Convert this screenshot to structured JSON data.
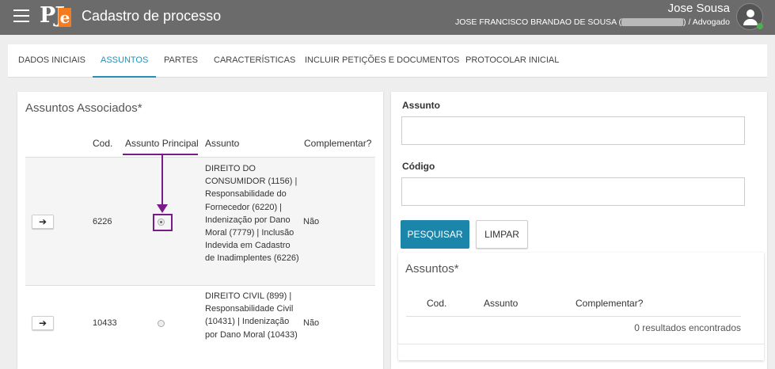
{
  "topbar": {
    "menu_icon": "hamburger-icon",
    "logo_text": "PJ",
    "logo_e": "e",
    "title": "Cadastro de processo",
    "user_name": "Jose Sousa",
    "user_full_prefix": "JOSE FRANCISCO BRANDAO DE SOUSA (",
    "user_full_suffix": ") / Advogado",
    "avatar_icon": "user-icon",
    "status_color": "#4caf50"
  },
  "tabs": [
    {
      "label": "DADOS INICIAIS"
    },
    {
      "label": "ASSUNTOS"
    },
    {
      "label": "PARTES"
    },
    {
      "label": "CARACTERÍSTICAS"
    },
    {
      "label": "INCLUIR PETIÇÕES E DOCUMENTOS"
    },
    {
      "label": "PROTOCOLAR INICIAL"
    }
  ],
  "active_tab": "ASSUNTOS",
  "associados": {
    "title": "Assuntos Associados*",
    "headers": {
      "cod": "Cod.",
      "principal": "Assunto Principal",
      "assunto": "Assunto",
      "complementar": "Complementar?"
    },
    "rows": [
      {
        "arrow": "➔",
        "cod": "6226",
        "principal": true,
        "assunto": "DIREITO DO CONSUMIDOR (1156) | Responsabilidade do Fornecedor (6220) | Indenização por Dano Moral (7779) | Inclusão Indevida em Cadastro de Inadimplentes (6226)",
        "complementar": "Não"
      },
      {
        "arrow": "➔",
        "cod": "10433",
        "principal": false,
        "assunto": "DIREITO CIVIL (899) | Responsabilidade Civil (10431) | Indenização por Dano Moral (10433)",
        "complementar": "Não"
      }
    ]
  },
  "search": {
    "assunto_label": "Assunto",
    "assunto_value": "",
    "codigo_label": "Código",
    "codigo_value": "",
    "pesquisar_label": "PESQUISAR",
    "limpar_label": "LIMPAR"
  },
  "resultados": {
    "title": "Assuntos*",
    "headers": {
      "cod": "Cod.",
      "assunto": "Assunto",
      "complementar": "Complementar?"
    },
    "empty_text": "0 resultados encontrados"
  },
  "colors": {
    "accent": "#1b86a9",
    "annotation": "#7a1b8a",
    "topbar": "#6b6b6b"
  }
}
